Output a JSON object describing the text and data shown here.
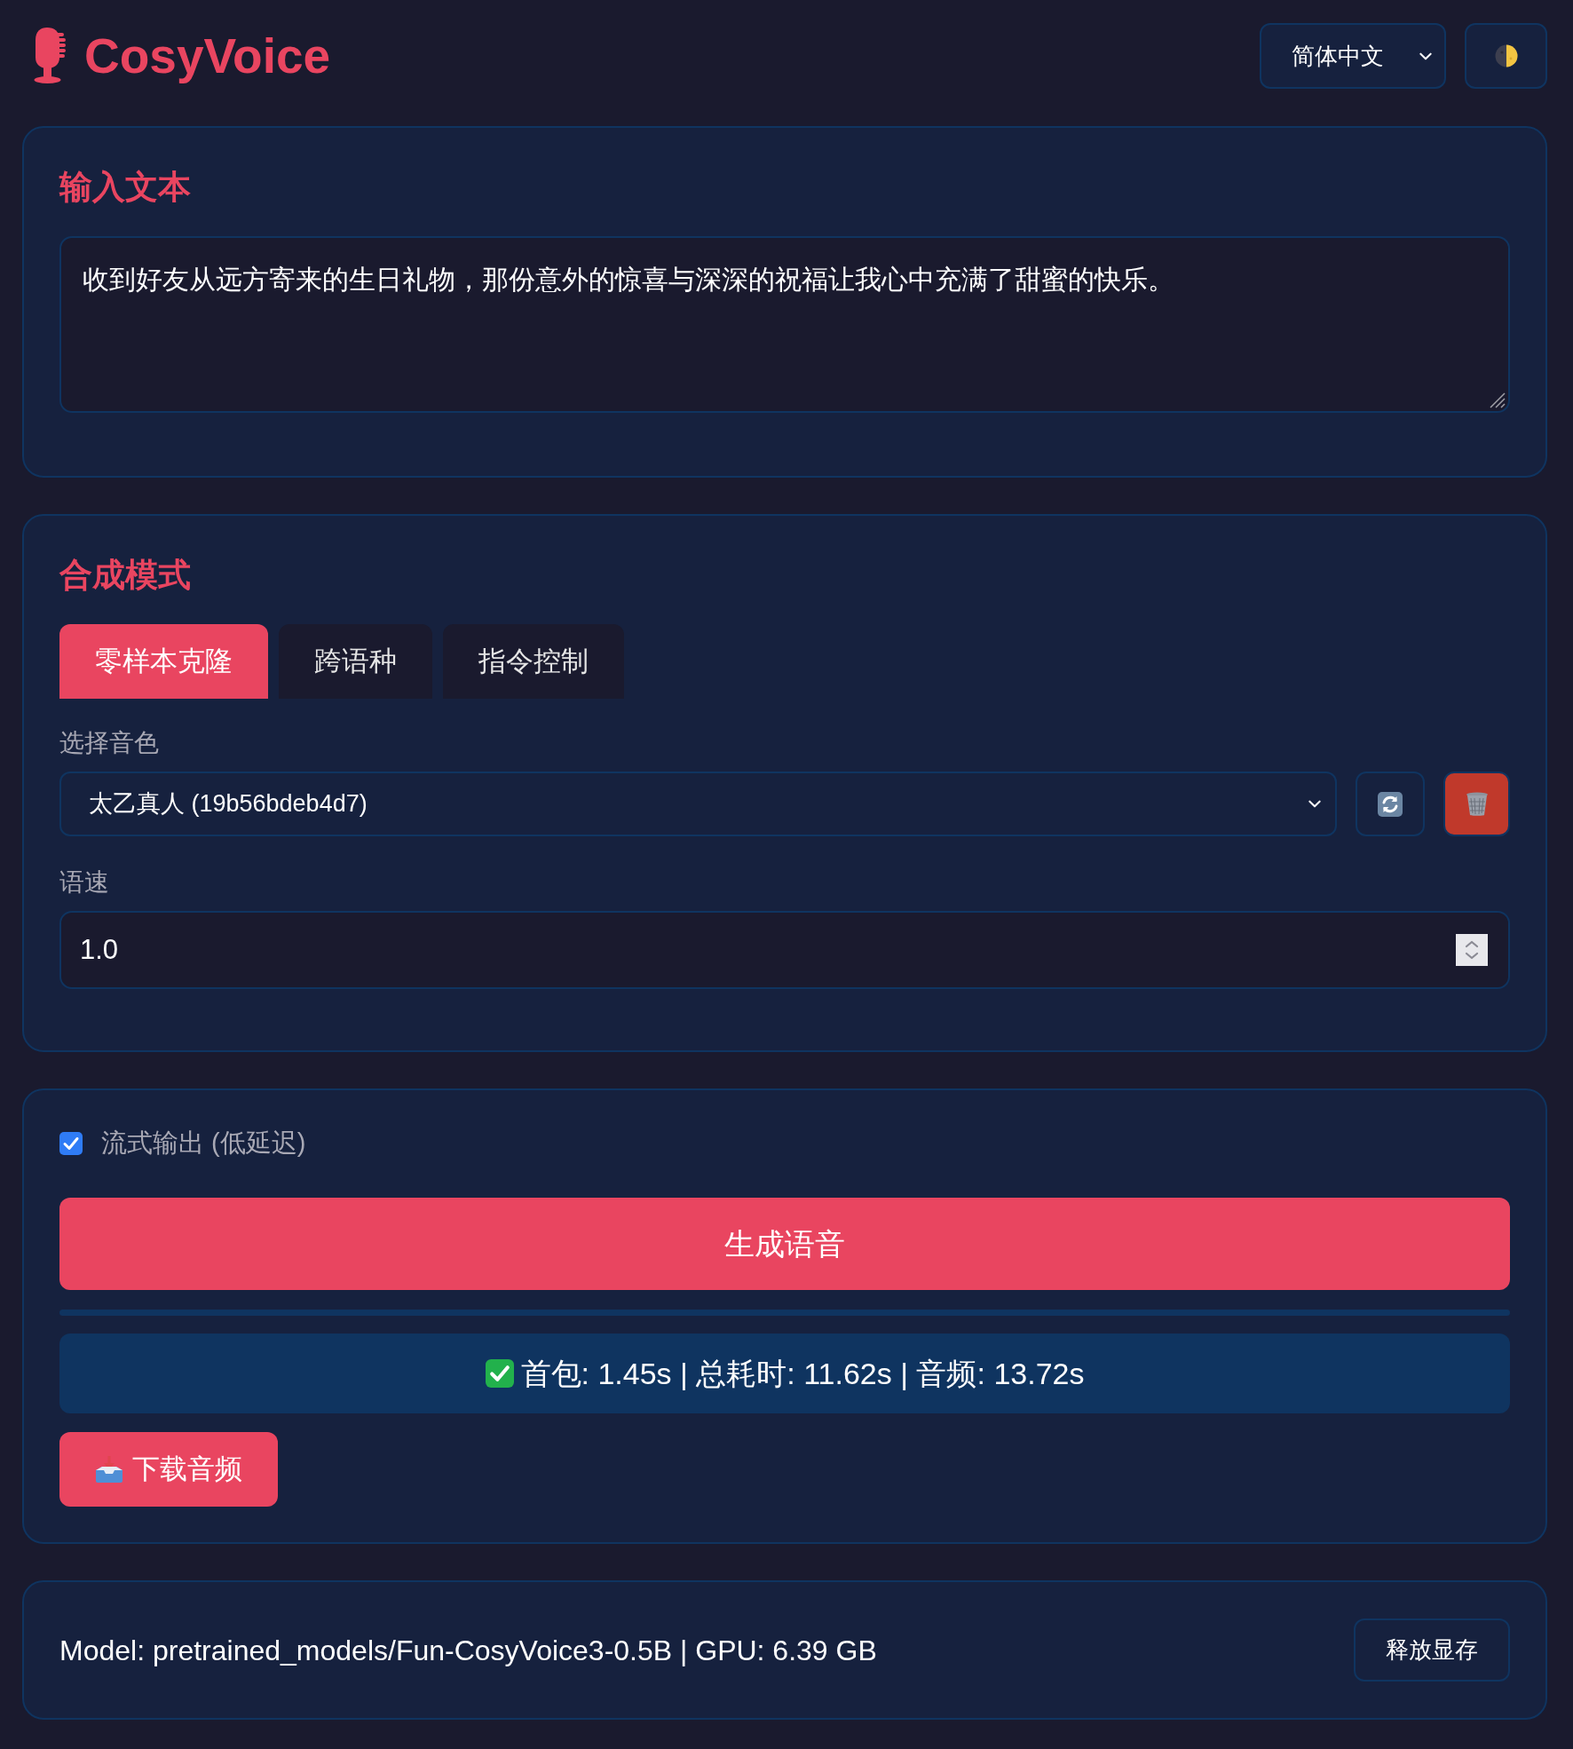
{
  "header": {
    "logo_text": "CosyVoice",
    "language_select": {
      "value": "简体中文"
    }
  },
  "input_card": {
    "heading": "输入文本",
    "textarea": {
      "value": "收到好友从远方寄来的生日礼物，那份意外的惊喜与深深的祝福让我心中充满了甜蜜的快乐。"
    }
  },
  "mode_card": {
    "heading": "合成模式",
    "tabs": [
      {
        "label": "零样本克隆",
        "selected": true
      },
      {
        "label": "跨语种",
        "selected": false
      },
      {
        "label": "指令控制",
        "selected": false
      }
    ],
    "voice": {
      "label": "选择音色",
      "value": "太乙真人 (19b56bdeb4d7)"
    },
    "speed": {
      "label": "语速",
      "value": "1.0"
    }
  },
  "output_card": {
    "streaming": {
      "label": "流式输出 (低延迟)",
      "checked": true
    },
    "generate_button": "生成语音",
    "status": {
      "kind": "success",
      "text": "首包: 1.45s | 总耗时: 11.62s | 音频: 13.72s"
    },
    "download_button": "下载音频"
  },
  "footer": {
    "model_info": "Model: pretrained_models/Fun-CosyVoice3-0.5B | GPU: 6.39 GB",
    "release_button": "释放显存"
  }
}
